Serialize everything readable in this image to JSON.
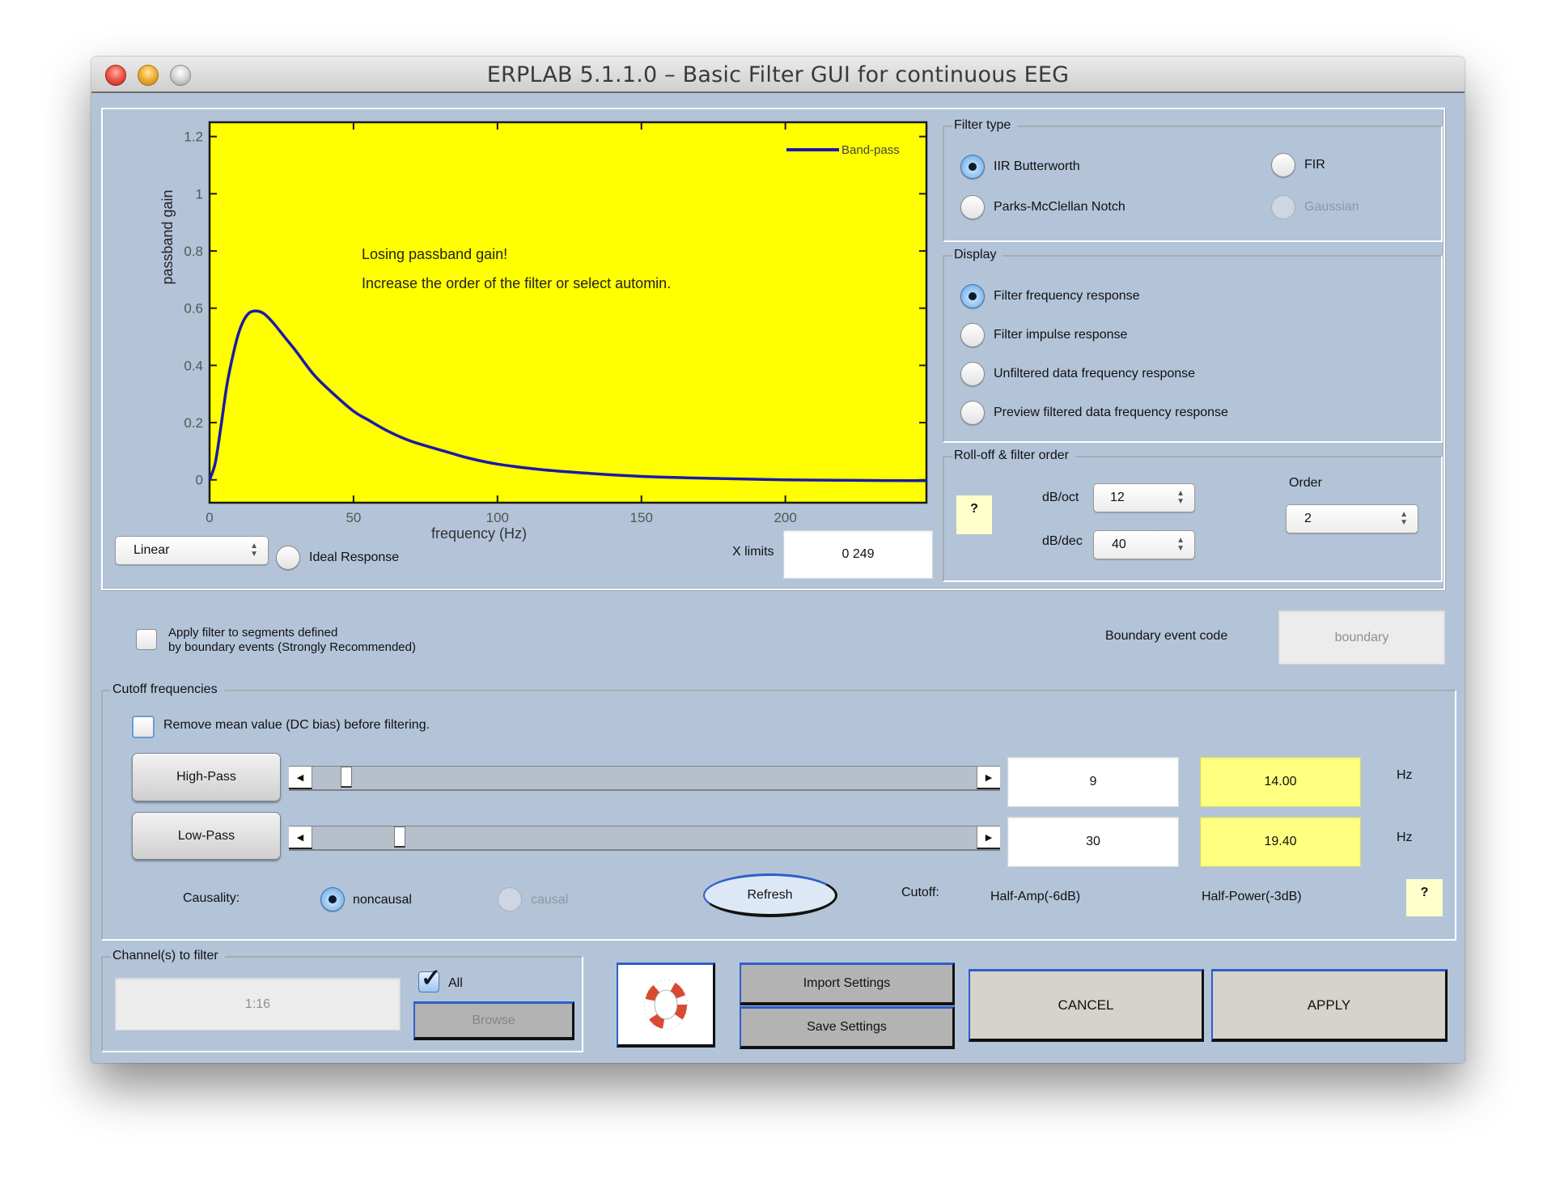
{
  "window": {
    "title": "ERPLAB 5.1.1.0   –   Basic Filter GUI for continuous EEG",
    "controls": [
      "close",
      "minimize",
      "zoom"
    ]
  },
  "plot": {
    "warning_line1": "Losing passband gain!",
    "warning_line2": "Increase the order of the filter or select automin.",
    "scale_select": "Linear",
    "ideal_response_label": "Ideal Response",
    "ideal_response_checked": false,
    "xlimits_label": "X limits",
    "xlimits_value": "0  249"
  },
  "chart_data": {
    "type": "line",
    "title": "",
    "xlabel": "frequency (Hz)",
    "ylabel": "passband gain",
    "xlim": [
      0,
      249
    ],
    "ylim": [
      -0.08,
      1.25
    ],
    "xticks": [
      0,
      50,
      100,
      150,
      200
    ],
    "yticks": [
      0,
      0.2,
      0.4,
      0.6,
      0.8,
      1,
      1.2
    ],
    "ytick_labels": [
      "0",
      "0.2",
      "0.4",
      "0.6",
      "0.8",
      "1",
      "1.2"
    ],
    "background": "#ffff00",
    "legend": {
      "position": "top-right",
      "entries": [
        "Band-pass"
      ]
    },
    "series": [
      {
        "name": "Band-pass",
        "color": "#1a1aa6",
        "x": [
          0,
          2,
          4,
          6,
          8,
          10,
          12,
          14,
          16.6,
          19,
          22,
          26,
          30,
          36,
          42,
          50,
          55,
          62,
          70,
          83,
          90,
          100,
          115,
          130,
          150,
          175,
          200,
          225,
          249
        ],
        "y": [
          0,
          0.06,
          0.19,
          0.33,
          0.43,
          0.51,
          0.56,
          0.585,
          0.59,
          0.58,
          0.55,
          0.5,
          0.45,
          0.37,
          0.31,
          0.24,
          0.21,
          0.17,
          0.135,
          0.096,
          0.076,
          0.055,
          0.036,
          0.024,
          0.012,
          0.005,
          0.0,
          -0.002,
          -0.003
        ]
      }
    ]
  },
  "filter_type": {
    "label": "Filter type",
    "options": [
      {
        "label": "IIR Butterworth",
        "selected": true,
        "enabled": true
      },
      {
        "label": "FIR",
        "selected": false,
        "enabled": true
      },
      {
        "label": "Parks-McClellan Notch",
        "selected": false,
        "enabled": true
      },
      {
        "label": "Gaussian",
        "selected": false,
        "enabled": false
      }
    ]
  },
  "display": {
    "label": "Display",
    "options": [
      {
        "label": "Filter frequency response",
        "selected": true
      },
      {
        "label": "Filter impulse response",
        "selected": false
      },
      {
        "label": "Unfiltered data frequency response",
        "selected": false
      },
      {
        "label": "Preview filtered data frequency response",
        "selected": false
      }
    ]
  },
  "rolloff": {
    "label": "Roll-off & filter order",
    "help": "?",
    "db_oct_label": "dB/oct",
    "db_oct_value": "12",
    "db_dec_label": "dB/dec",
    "db_dec_value": "40",
    "order_label": "Order",
    "order_value": "2"
  },
  "boundary": {
    "apply_label_line1": "Apply filter to segments defined",
    "apply_label_line2": "by boundary events (Strongly Recommended)",
    "apply_checked": false,
    "code_label": "Boundary event code",
    "code_value": "boundary"
  },
  "cutoff": {
    "label": "Cutoff frequencies",
    "remove_dc_label": "Remove mean value (DC bias) before filtering.",
    "remove_dc_checked": false,
    "highpass": {
      "button": "High-Pass",
      "value": "9",
      "half_power": "14.00",
      "unit": "Hz",
      "slider_fraction": 0.045
    },
    "lowpass": {
      "button": "Low-Pass",
      "value": "30",
      "half_power": "19.40",
      "unit": "Hz",
      "slider_fraction": 0.126
    },
    "causality_label": "Causality:",
    "causality_options": [
      {
        "label": "noncausal",
        "selected": true,
        "enabled": true
      },
      {
        "label": "causal",
        "selected": false,
        "enabled": false
      }
    ],
    "refresh_label": "Refresh",
    "cutoff_label": "Cutoff:",
    "half_amp_label": "Half-Amp(-6dB)",
    "half_power_label": "Half-Power(-3dB)",
    "help": "?"
  },
  "channels": {
    "label": "Channel(s) to filter",
    "value": "1:16",
    "all_label": "All",
    "all_checked": true,
    "browse_label": "Browse"
  },
  "actions": {
    "help_icon": "lifebuoy-icon",
    "import_label": "Import Settings",
    "save_label": "Save Settings",
    "cancel_label": "CANCEL",
    "apply_label": "APPLY"
  }
}
